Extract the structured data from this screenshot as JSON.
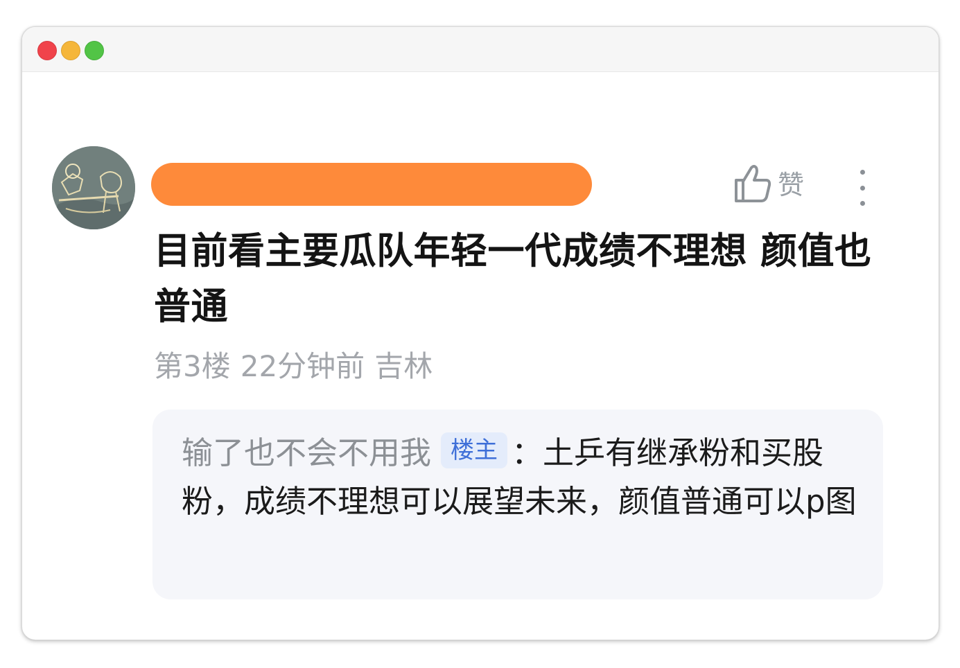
{
  "window": {
    "controls": [
      "close",
      "minimize",
      "maximize"
    ]
  },
  "comment": {
    "avatar_icon": "user-avatar",
    "like_label": "赞",
    "like_icon": "thumbs-up-icon",
    "more_icon": "vertical-ellipsis-icon",
    "text": "目前看主要瓜队年轻一代成绩不理想 颜值也普通",
    "floor": "第3楼",
    "time": "22分钟前",
    "location": "吉林"
  },
  "quote": {
    "author": "输了也不会不用我",
    "badge": "楼主",
    "separator": "：",
    "text": "土乒有继承粉和买股粉，成绩不理想可以展望未来，颜值普通可以p图"
  },
  "colors": {
    "redaction": "#fe8a3a",
    "meta_text": "#a3a6ab",
    "badge_bg": "#e4ecfb",
    "badge_text": "#3e6fd8",
    "quote_bg": "#f5f6fa"
  }
}
